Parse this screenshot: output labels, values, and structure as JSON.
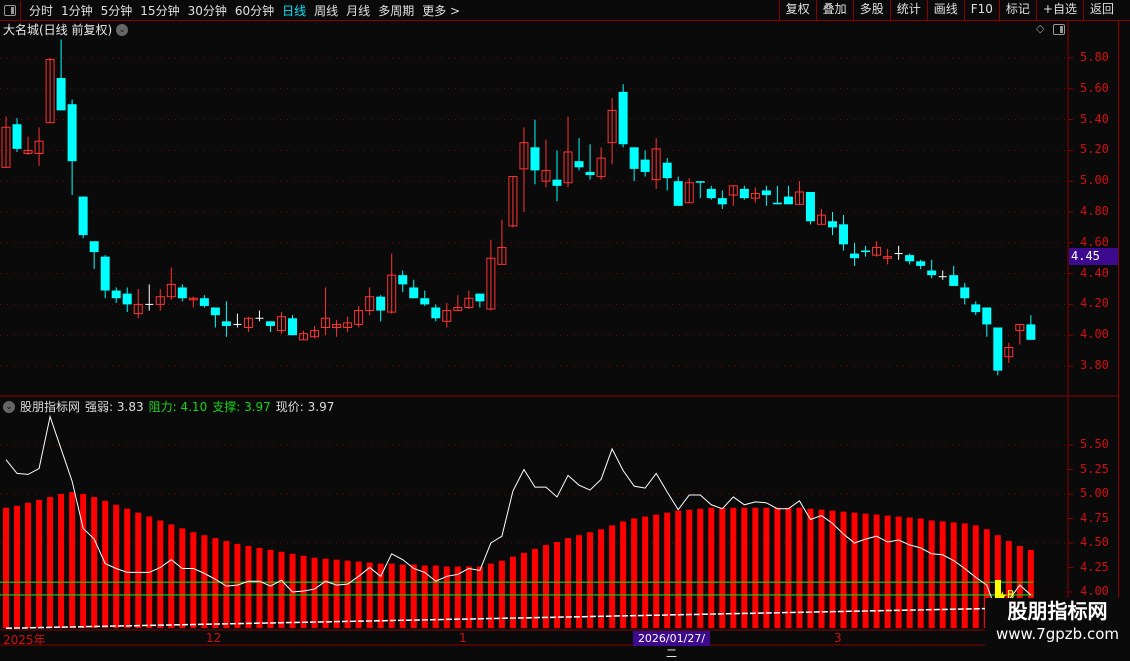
{
  "toolbar": {
    "periods": [
      "分时",
      "1分钟",
      "5分钟",
      "15分钟",
      "30分钟",
      "60分钟",
      "日线",
      "周线",
      "月线",
      "多周期",
      "更多 >"
    ],
    "active_period": "日线",
    "right_buttons": [
      "复权",
      "叠加",
      "多股",
      "统计",
      "画线",
      "F10",
      "标记",
      "+自选",
      "返回"
    ]
  },
  "chart": {
    "title": "大名城(日线 前复权)",
    "price_ticks": [
      "5.80",
      "5.60",
      "5.40",
      "5.20",
      "5.00",
      "4.80",
      "4.60",
      "4.40",
      "4.20",
      "4.00",
      "3.80"
    ],
    "current_price_tag": "4.45",
    "colors": {
      "up": "#ff3232",
      "down": "#00ffff",
      "flat": "#ffffff",
      "grid": "#8b0000",
      "axis_text": "#d01010"
    }
  },
  "chart_data": [
    {
      "type": "candlestick",
      "ylim": [
        3.72,
        5.94
      ],
      "ohlc_fields": [
        "open",
        "high",
        "low",
        "close"
      ],
      "candles": [
        [
          5.09,
          5.42,
          5.09,
          5.35
        ],
        [
          5.37,
          5.41,
          5.19,
          5.21
        ],
        [
          5.18,
          5.29,
          5.17,
          5.2
        ],
        [
          5.18,
          5.35,
          5.1,
          5.26
        ],
        [
          5.38,
          5.8,
          5.38,
          5.79
        ],
        [
          5.67,
          5.92,
          5.46,
          5.46
        ],
        [
          5.5,
          5.53,
          4.91,
          5.13
        ],
        [
          4.9,
          4.9,
          4.63,
          4.65
        ],
        [
          4.61,
          4.61,
          4.43,
          4.54
        ],
        [
          4.51,
          4.52,
          4.24,
          4.29
        ],
        [
          4.29,
          4.31,
          4.21,
          4.24
        ],
        [
          4.27,
          4.31,
          4.15,
          4.2
        ],
        [
          4.14,
          4.3,
          4.11,
          4.2
        ],
        [
          4.2,
          4.33,
          4.16,
          4.2
        ],
        [
          4.2,
          4.3,
          4.16,
          4.25
        ],
        [
          4.25,
          4.44,
          4.23,
          4.33
        ],
        [
          4.31,
          4.33,
          4.22,
          4.24
        ],
        [
          4.23,
          4.25,
          4.18,
          4.24
        ],
        [
          4.24,
          4.26,
          4.18,
          4.19
        ],
        [
          4.18,
          4.18,
          4.05,
          4.13
        ],
        [
          4.09,
          4.22,
          3.99,
          4.06
        ],
        [
          4.07,
          4.14,
          4.05,
          4.07
        ],
        [
          4.05,
          4.12,
          4.02,
          4.11
        ],
        [
          4.11,
          4.16,
          4.09,
          4.11
        ],
        [
          4.09,
          4.09,
          4.02,
          4.06
        ],
        [
          4.03,
          4.15,
          4.01,
          4.12
        ],
        [
          4.11,
          4.13,
          4.0,
          4.0
        ],
        [
          3.97,
          4.03,
          3.97,
          4.01
        ],
        [
          3.99,
          4.06,
          3.98,
          4.03
        ],
        [
          4.05,
          4.31,
          4.0,
          4.11
        ],
        [
          4.05,
          4.1,
          3.99,
          4.07
        ],
        [
          4.05,
          4.12,
          4.02,
          4.08
        ],
        [
          4.07,
          4.19,
          4.05,
          4.16
        ],
        [
          4.16,
          4.31,
          4.13,
          4.25
        ],
        [
          4.25,
          4.26,
          4.09,
          4.16
        ],
        [
          4.15,
          4.53,
          4.14,
          4.39
        ],
        [
          4.39,
          4.42,
          4.28,
          4.33
        ],
        [
          4.31,
          4.36,
          4.24,
          4.24
        ],
        [
          4.24,
          4.29,
          4.19,
          4.2
        ],
        [
          4.18,
          4.2,
          4.09,
          4.11
        ],
        [
          4.09,
          4.21,
          4.05,
          4.16
        ],
        [
          4.16,
          4.26,
          4.16,
          4.18
        ],
        [
          4.18,
          4.29,
          4.17,
          4.24
        ],
        [
          4.27,
          4.27,
          4.18,
          4.22
        ],
        [
          4.17,
          4.62,
          4.16,
          4.5
        ],
        [
          4.46,
          4.75,
          4.46,
          4.57
        ],
        [
          4.71,
          5.03,
          4.7,
          5.03
        ],
        [
          5.08,
          5.35,
          4.8,
          5.25
        ],
        [
          5.22,
          5.4,
          4.98,
          5.07
        ],
        [
          5.0,
          5.27,
          4.96,
          5.07
        ],
        [
          5.01,
          5.2,
          4.87,
          4.97
        ],
        [
          4.99,
          5.42,
          4.96,
          5.19
        ],
        [
          5.13,
          5.28,
          5.07,
          5.09
        ],
        [
          5.06,
          5.24,
          5.01,
          5.04
        ],
        [
          5.03,
          5.22,
          5.01,
          5.15
        ],
        [
          5.25,
          5.54,
          5.11,
          5.46
        ],
        [
          5.58,
          5.63,
          5.22,
          5.24
        ],
        [
          5.22,
          5.22,
          5.0,
          5.08
        ],
        [
          5.14,
          5.2,
          5.03,
          5.06
        ],
        [
          5.01,
          5.28,
          4.95,
          5.21
        ],
        [
          5.12,
          5.15,
          4.94,
          5.02
        ],
        [
          5.0,
          5.03,
          4.84,
          4.84
        ],
        [
          4.86,
          5.02,
          4.86,
          4.99
        ],
        [
          5.0,
          5.0,
          4.89,
          4.99
        ],
        [
          4.95,
          4.97,
          4.88,
          4.89
        ],
        [
          4.89,
          4.94,
          4.82,
          4.85
        ],
        [
          4.91,
          4.97,
          4.84,
          4.97
        ],
        [
          4.95,
          4.97,
          4.88,
          4.89
        ],
        [
          4.89,
          4.96,
          4.86,
          4.92
        ],
        [
          4.94,
          4.97,
          4.84,
          4.91
        ],
        [
          4.86,
          4.97,
          4.85,
          4.85
        ],
        [
          4.9,
          4.97,
          4.85,
          4.85
        ],
        [
          4.85,
          5.0,
          4.85,
          4.93
        ],
        [
          4.93,
          4.93,
          4.72,
          4.74
        ],
        [
          4.72,
          4.82,
          4.72,
          4.78
        ],
        [
          4.74,
          4.8,
          4.65,
          4.7
        ],
        [
          4.72,
          4.78,
          4.55,
          4.59
        ],
        [
          4.53,
          4.6,
          4.45,
          4.5
        ],
        [
          4.55,
          4.58,
          4.51,
          4.54
        ],
        [
          4.52,
          4.61,
          4.51,
          4.57
        ],
        [
          4.5,
          4.56,
          4.46,
          4.51
        ],
        [
          4.53,
          4.58,
          4.49,
          4.53
        ],
        [
          4.52,
          4.53,
          4.46,
          4.48
        ],
        [
          4.48,
          4.49,
          4.43,
          4.45
        ],
        [
          4.42,
          4.49,
          4.37,
          4.39
        ],
        [
          4.38,
          4.42,
          4.36,
          4.38
        ],
        [
          4.39,
          4.45,
          4.32,
          4.32
        ],
        [
          4.31,
          4.34,
          4.2,
          4.24
        ],
        [
          4.2,
          4.22,
          4.13,
          4.15
        ],
        [
          4.18,
          4.18,
          3.99,
          4.07
        ],
        [
          4.05,
          4.05,
          3.74,
          3.77
        ],
        [
          3.86,
          3.95,
          3.82,
          3.92
        ],
        [
          4.03,
          4.07,
          3.94,
          4.07
        ],
        [
          4.07,
          4.13,
          3.97,
          3.97
        ]
      ],
      "y_ticks": [
        5.8,
        5.6,
        5.4,
        5.2,
        5.0,
        4.8,
        4.6,
        4.4,
        4.2,
        4.0,
        3.8
      ]
    },
    {
      "type": "bar",
      "ylim": [
        3.66,
        5.72
      ],
      "y_ticks": [
        5.5,
        5.25,
        5.0,
        4.75,
        4.5,
        4.25,
        4.0
      ],
      "bars": [
        4.86,
        4.88,
        4.91,
        4.94,
        4.97,
        5.0,
        5.02,
        5.0,
        4.97,
        4.93,
        4.89,
        4.85,
        4.81,
        4.77,
        4.73,
        4.69,
        4.65,
        4.61,
        4.58,
        4.55,
        4.52,
        4.49,
        4.47,
        4.45,
        4.43,
        4.41,
        4.39,
        4.37,
        4.35,
        4.34,
        4.33,
        4.32,
        4.31,
        4.3,
        4.29,
        4.29,
        4.28,
        4.28,
        4.27,
        4.27,
        4.26,
        4.26,
        4.26,
        4.26,
        4.29,
        4.32,
        4.36,
        4.4,
        4.44,
        4.48,
        4.51,
        4.55,
        4.58,
        4.61,
        4.64,
        4.68,
        4.72,
        4.75,
        4.77,
        4.79,
        4.81,
        4.83,
        4.84,
        4.85,
        4.86,
        4.86,
        4.86,
        4.86,
        4.86,
        4.86,
        4.86,
        4.86,
        4.86,
        4.85,
        4.84,
        4.83,
        4.82,
        4.81,
        4.8,
        4.79,
        4.78,
        4.77,
        4.76,
        4.75,
        4.73,
        4.72,
        4.71,
        4.7,
        4.68,
        4.64,
        4.58,
        4.52,
        4.47,
        4.43
      ],
      "price_line": "close",
      "lower_dashed_line": {
        "start": 3.63,
        "end": 3.84
      },
      "resistance": 4.1,
      "support": 3.97,
      "signal_label": "B"
    }
  ],
  "indicator": {
    "name": "股朋指标网",
    "strength_label": "强弱:",
    "strength_value": "3.83",
    "resistance_label": "阻力:",
    "resistance_value": "4.10",
    "support_label": "支撑:",
    "support_value": "3.97",
    "price_label": "现价:",
    "price_value": "3.97",
    "ticks": [
      "5.50",
      "5.25",
      "5.00",
      "4.75",
      "4.50",
      "4.25",
      "4.00"
    ],
    "colors": {
      "bar": "#ff0000",
      "line": "#ffffff",
      "resistance": "#19d219",
      "signal": "#ffff00"
    }
  },
  "time_axis": {
    "labels": [
      "2025年",
      "12",
      "1",
      "3"
    ],
    "cursor_date": "2026/01/27/二"
  },
  "watermark": {
    "line1": "股朋指标网",
    "line2": "www.7gpzb.com"
  }
}
